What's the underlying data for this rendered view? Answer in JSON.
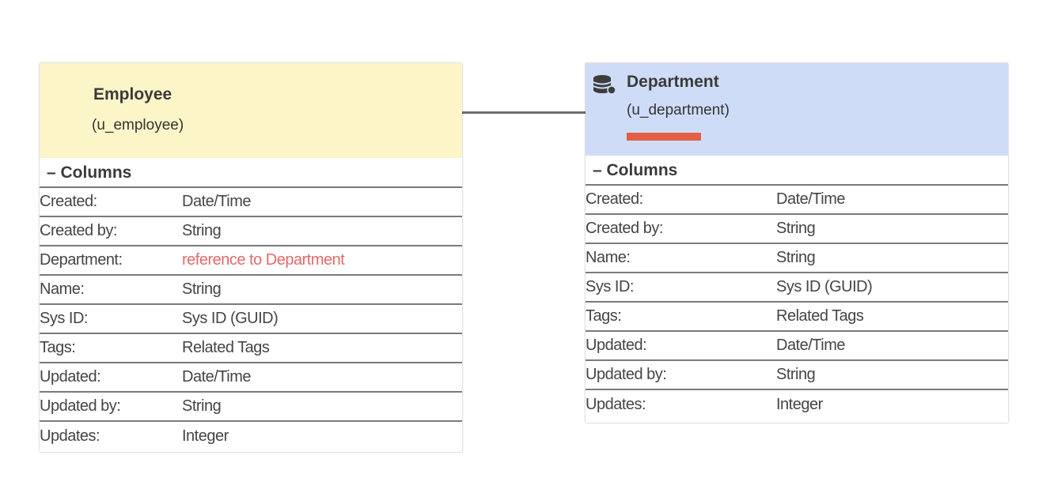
{
  "tables": [
    {
      "id": "employee",
      "title": "Employee",
      "subtitle": "(u_employee)",
      "header_color": "#fbf5c8",
      "section_label": "– Columns",
      "columns": [
        {
          "name": "Created:",
          "type": "Date/Time"
        },
        {
          "name": "Created by:",
          "type": "String"
        },
        {
          "name": "Department:",
          "type": "reference to Department",
          "is_reference": true
        },
        {
          "name": "Name:",
          "type": "String"
        },
        {
          "name": "Sys ID:",
          "type": "Sys ID (GUID)"
        },
        {
          "name": "Tags:",
          "type": "Related Tags"
        },
        {
          "name": "Updated:",
          "type": "Date/Time"
        },
        {
          "name": "Updated by:",
          "type": "String"
        },
        {
          "name": "Updates:",
          "type": "Integer"
        }
      ]
    },
    {
      "id": "department",
      "title": "Department",
      "subtitle": "(u_department)",
      "header_color": "#cfdcf8",
      "icon": "database-icon",
      "accent_color": "#e35f44",
      "section_label": "– Columns",
      "columns": [
        {
          "name": "Created:",
          "type": "Date/Time"
        },
        {
          "name": "Created by:",
          "type": "String"
        },
        {
          "name": "Name:",
          "type": "String"
        },
        {
          "name": "Sys ID:",
          "type": "Sys ID (GUID)"
        },
        {
          "name": "Tags:",
          "type": "Related Tags"
        },
        {
          "name": "Updated:",
          "type": "Date/Time"
        },
        {
          "name": "Updated by:",
          "type": "String"
        },
        {
          "name": "Updates:",
          "type": "Integer"
        }
      ]
    }
  ],
  "reference_color": "#e56a6a"
}
